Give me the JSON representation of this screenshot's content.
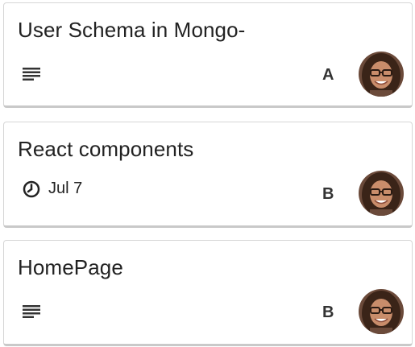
{
  "cards": [
    {
      "title": "User Schema in Mongo-",
      "badge": "description",
      "member_initial": "A"
    },
    {
      "title": "React components",
      "badge": "due",
      "due_date": "Jul 7",
      "member_initial": "B"
    },
    {
      "title": "HomePage",
      "badge": "description",
      "member_initial": "B"
    }
  ],
  "icons": {
    "description": "description-lines-icon",
    "due": "clock-icon",
    "avatar": "member-avatar"
  },
  "colors": {
    "card_border": "#d6d6d6",
    "card_shadow": "#c9c9c9",
    "text": "#222222",
    "initial": "#333333"
  }
}
